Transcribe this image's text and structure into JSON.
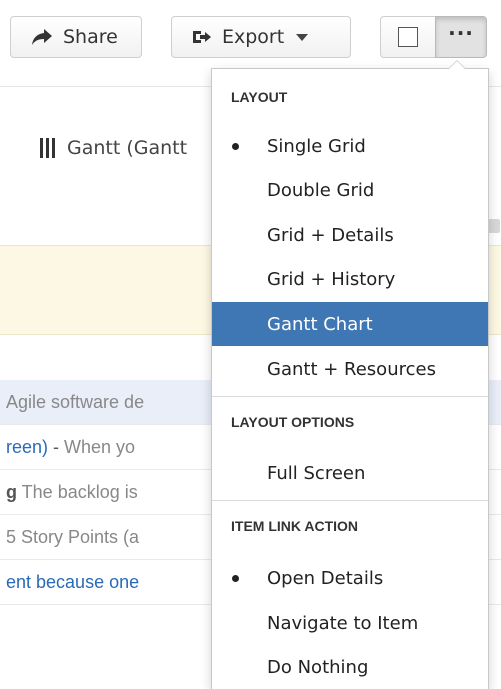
{
  "toolbar": {
    "share_label": "Share",
    "export_label": "Export"
  },
  "view": {
    "gantt_tab_label": "Gantt (Gantt"
  },
  "rows": [
    {
      "parts": [
        {
          "text": "Agile software de",
          "style": "gray"
        }
      ]
    },
    {
      "parts": [
        {
          "text": "reen)",
          "style": "blue"
        },
        {
          "text": " - ",
          "style": "dark"
        },
        {
          "text": "When yo",
          "style": "gray"
        }
      ]
    },
    {
      "parts": [
        {
          "text": "g",
          "style": "dark-bold"
        },
        {
          "text": " The backlog is",
          "style": "gray"
        }
      ]
    },
    {
      "parts": [
        {
          "text": "5 Story Points (a",
          "style": "gray"
        }
      ]
    },
    {
      "parts": [
        {
          "text": "ent because one",
          "style": "blue"
        }
      ]
    }
  ],
  "menu": {
    "layout_header": "LAYOUT",
    "layout_items": [
      "Single Grid",
      "Double Grid",
      "Grid + Details",
      "Grid + History",
      "Gantt Chart",
      "Gantt + Resources"
    ],
    "layout_selected": "Single Grid",
    "layout_highlighted": "Gantt Chart",
    "options_header": "LAYOUT OPTIONS",
    "options_items": [
      "Full Screen"
    ],
    "link_header": "ITEM LINK ACTION",
    "link_items": [
      "Open Details",
      "Navigate to Item",
      "Do Nothing"
    ],
    "link_selected": "Open Details"
  },
  "colors": {
    "highlight": "#3e77b3",
    "link_blue": "#2a6ab8",
    "notice_band": "#fcf8e3",
    "selected_row": "#e9eef9"
  }
}
